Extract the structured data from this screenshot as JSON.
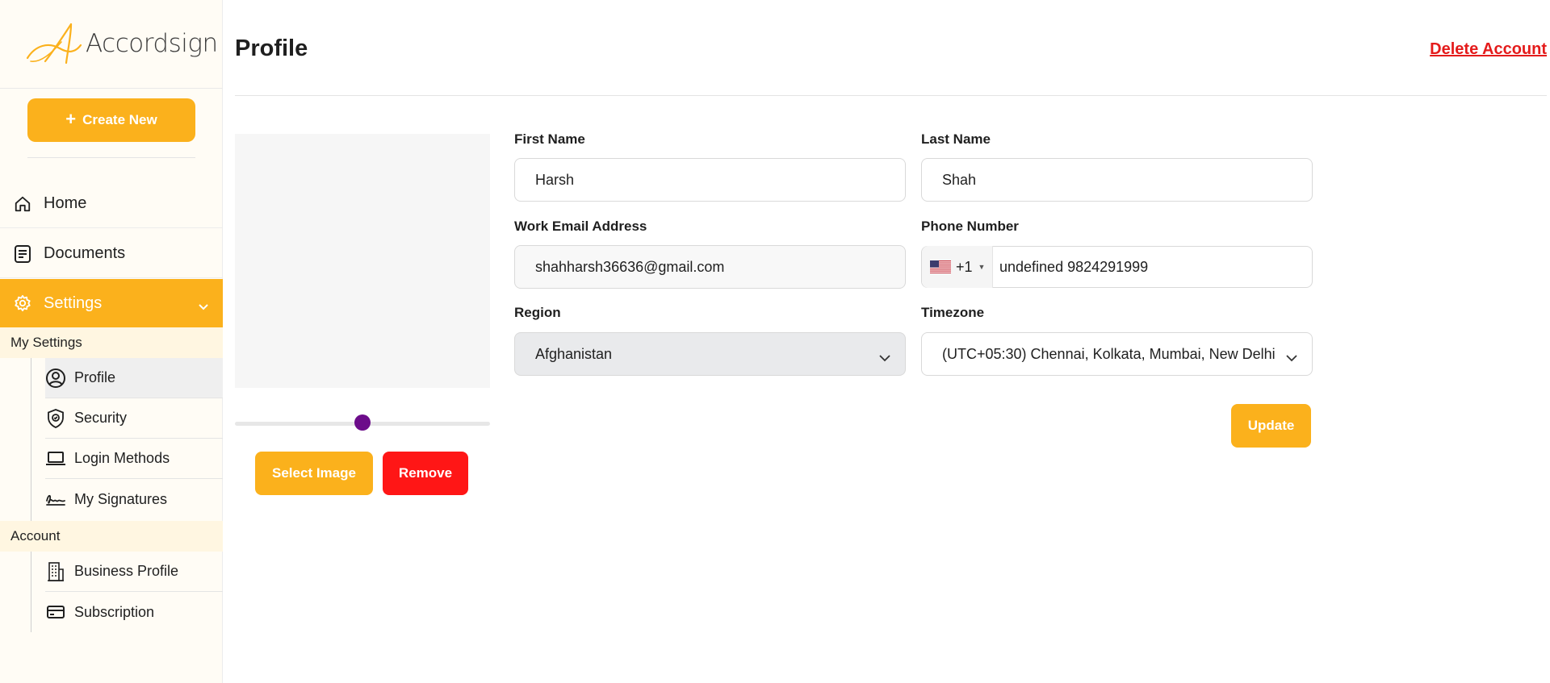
{
  "brand": {
    "name": "Accordsign",
    "accent": "#fbb11c",
    "danger": "#ff1616"
  },
  "sidebar": {
    "create_label": "Create New",
    "nav": [
      {
        "label": "Home",
        "icon": "home-icon"
      },
      {
        "label": "Documents",
        "icon": "document-icon"
      },
      {
        "label": "Settings",
        "icon": "gear-icon"
      }
    ],
    "groups": {
      "my_settings": "My Settings",
      "account": "Account"
    },
    "my_settings_items": [
      {
        "label": "Profile",
        "icon": "user-circle-icon"
      },
      {
        "label": "Security",
        "icon": "shield-icon"
      },
      {
        "label": "Login Methods",
        "icon": "laptop-icon"
      },
      {
        "label": "My Signatures",
        "icon": "signature-icon"
      }
    ],
    "account_items": [
      {
        "label": "Business Profile",
        "icon": "building-icon"
      },
      {
        "label": "Subscription",
        "icon": "credit-card-icon"
      }
    ]
  },
  "header": {
    "title": "Profile",
    "delete_label": "Delete Account"
  },
  "avatar": {
    "zoom_level": 0.5,
    "select_label": "Select Image",
    "remove_label": "Remove"
  },
  "form": {
    "first_name": {
      "label": "First Name",
      "value": "Harsh"
    },
    "last_name": {
      "label": "Last Name",
      "value": "Shah"
    },
    "email": {
      "label": "Work Email Address",
      "value": "shahharsh36636@gmail.com"
    },
    "phone": {
      "label": "Phone Number",
      "country_code": "+1",
      "value": "undefined 9824291999"
    },
    "region": {
      "label": "Region",
      "value": "Afghanistan"
    },
    "timezone": {
      "label": "Timezone",
      "value": "(UTC+05:30) Chennai, Kolkata, Mumbai, New Delhi"
    },
    "update_label": "Update"
  }
}
